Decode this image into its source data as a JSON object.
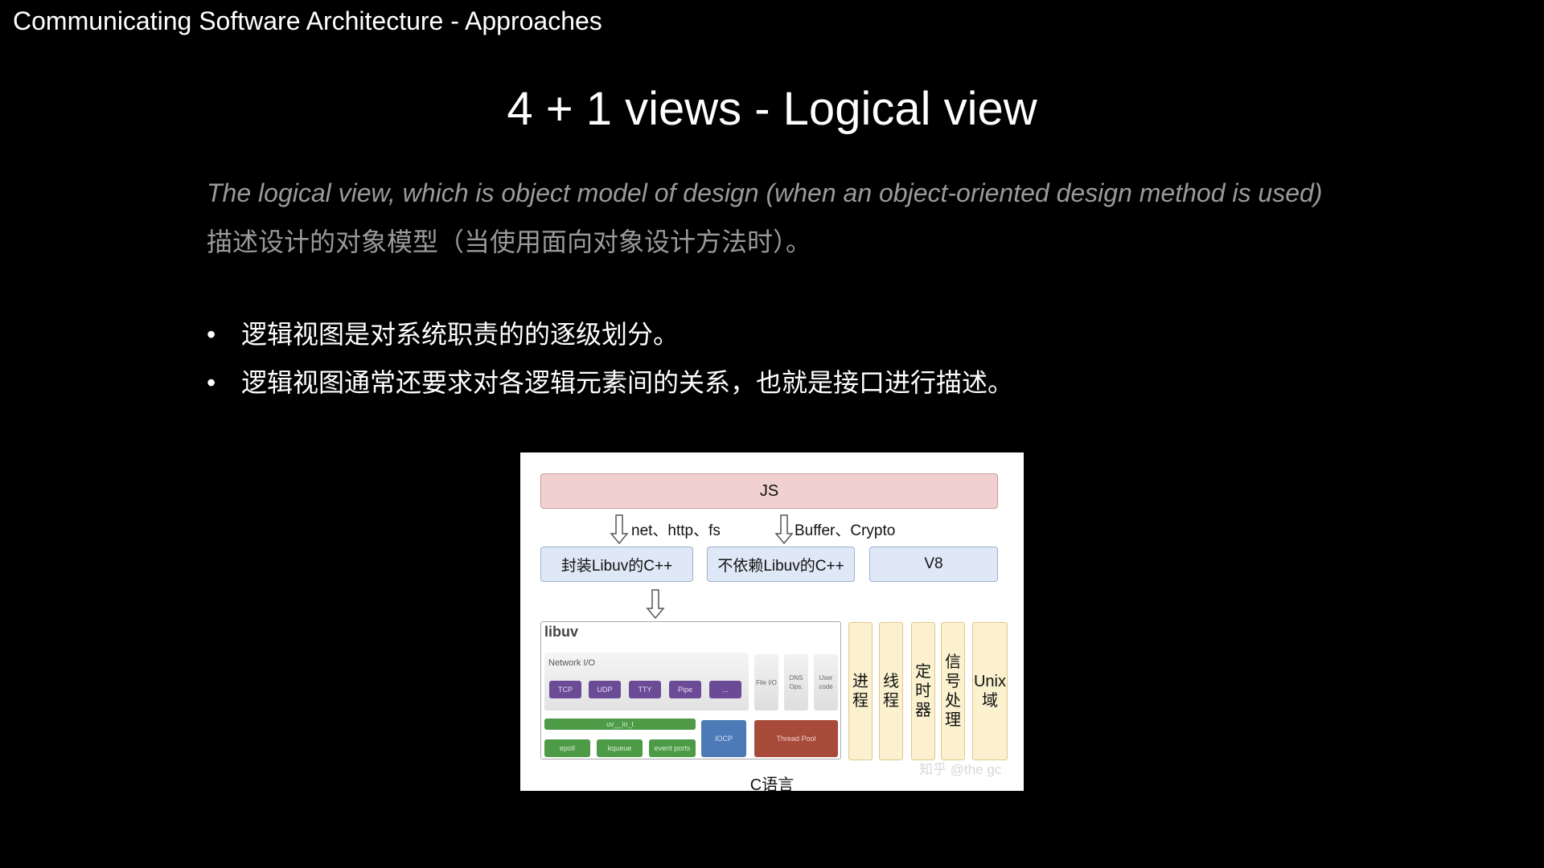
{
  "header": {
    "title": "Communicating Software Architecture - Approaches"
  },
  "slide": {
    "title": "4 + 1 views - Logical view",
    "quote_en": "The logical view, which is object model of design (when an object-oriented design method is used)",
    "quote_zh": "描述设计的对象模型（当使用面向对象设计方法时）。",
    "bullets": [
      "逻辑视图是对系统职责的的逐级划分。",
      "逻辑视图通常还要求对各逻辑元素间的关系，也就是接口进行描述。"
    ],
    "bullet_glyph": "•"
  },
  "diagram": {
    "js": "JS",
    "arrow_label_1": "net、http、fs",
    "arrow_label_2": "Buffer、Crypto",
    "cpp_boxes": [
      "封装Libuv的C++",
      "不依赖Libuv的C++",
      "V8"
    ],
    "libuv": {
      "label": "libuv",
      "network_io_label": "Network I/O",
      "pills": [
        "TCP",
        "UDP",
        "TTY",
        "Pipe",
        "..."
      ],
      "side_boxes": [
        "File I/O",
        "DNS Ops.",
        "User code"
      ],
      "uv_io": "uv__io_t",
      "backends": [
        "epoll",
        "kqueue",
        "event ports"
      ],
      "iocp": "IOCP",
      "thread_pool": "Thread Pool"
    },
    "columns": [
      "进\n程",
      "线\n程",
      "定\n时\n器",
      "信\n号\n处\n理",
      "Unix\n域"
    ],
    "footer": "C语言",
    "watermark": "知乎 @the gc",
    "colors": {
      "js_fill": "#f1d0d0",
      "cpp_fill": "#dfe8f7",
      "column_fill": "#fbf1cf",
      "pill_purple": "#6b4a96",
      "green": "#4d9a47",
      "iocp_blue": "#4c7ab6",
      "thread_pool_red": "#a84a3a"
    }
  }
}
